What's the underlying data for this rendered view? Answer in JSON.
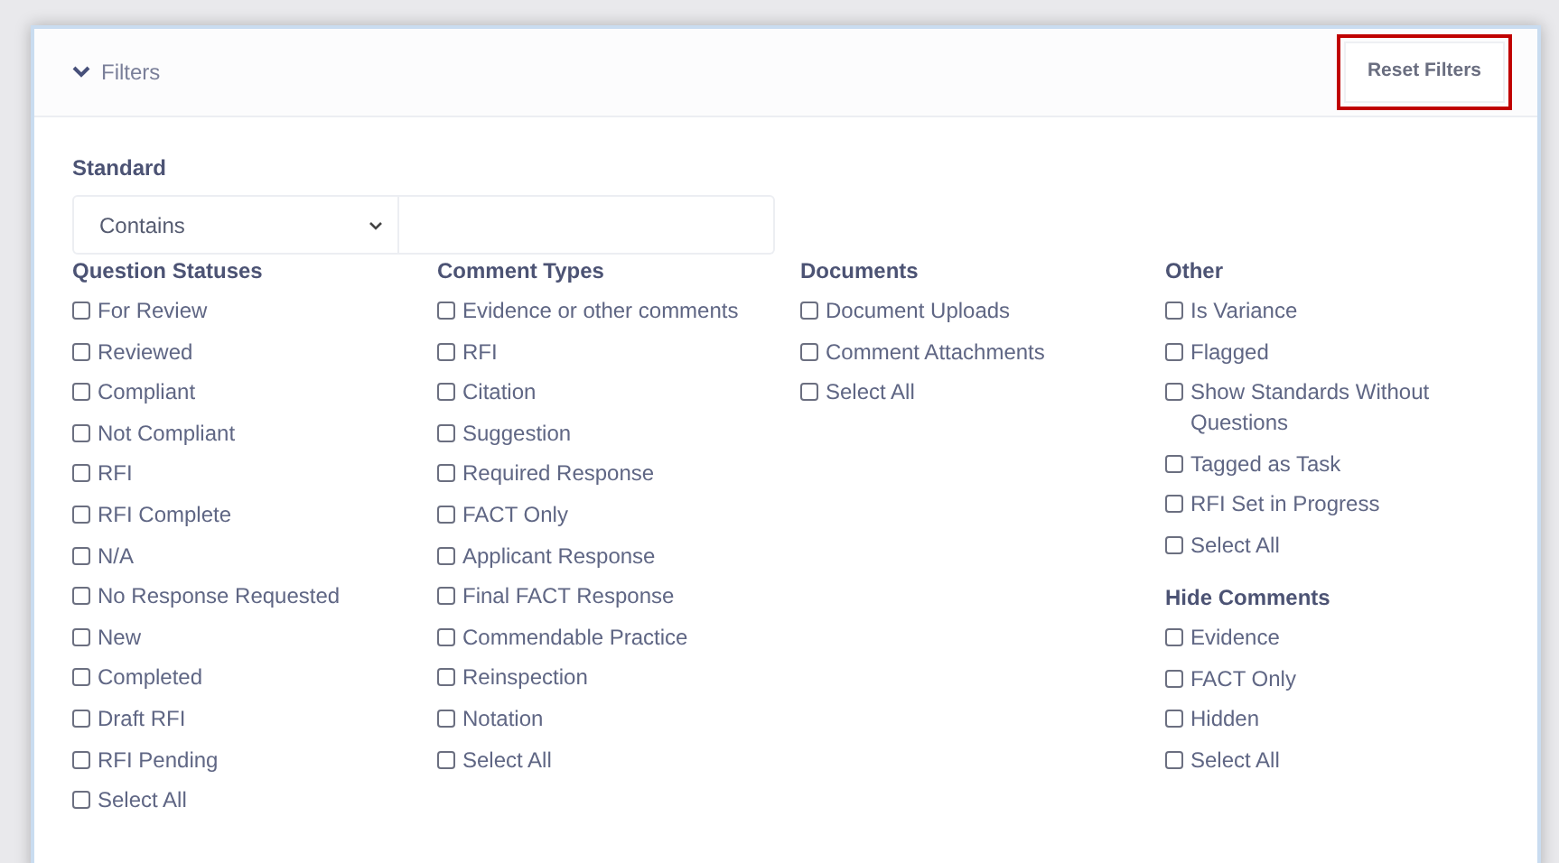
{
  "header": {
    "title": "Filters",
    "expanded": true,
    "reset_button": {
      "label": "Reset Filters",
      "highlighted": true
    }
  },
  "standard": {
    "label": "Standard",
    "operator": "Contains"
  },
  "columns": [
    {
      "groups": [
        {
          "title": "Question Statuses",
          "items": [
            {
              "label": "For Review",
              "checked": false
            },
            {
              "label": "Reviewed",
              "checked": false
            },
            {
              "label": "Compliant",
              "checked": false
            },
            {
              "label": "Not Compliant",
              "checked": false
            },
            {
              "label": "RFI",
              "checked": false
            },
            {
              "label": "RFI Complete",
              "checked": false
            },
            {
              "label": "N/A",
              "checked": false
            },
            {
              "label": "No Response Requested",
              "checked": false
            },
            {
              "label": "New",
              "checked": false
            },
            {
              "label": "Completed",
              "checked": false
            },
            {
              "label": "Draft RFI",
              "checked": false
            },
            {
              "label": "RFI Pending",
              "checked": false
            },
            {
              "label": "Select All",
              "checked": false
            }
          ]
        }
      ]
    },
    {
      "groups": [
        {
          "title": "Comment Types",
          "items": [
            {
              "label": "Evidence or other comments",
              "checked": false
            },
            {
              "label": "RFI",
              "checked": false
            },
            {
              "label": "Citation",
              "checked": false
            },
            {
              "label": "Suggestion",
              "checked": false
            },
            {
              "label": "Required Response",
              "checked": false
            },
            {
              "label": "FACT Only",
              "checked": false
            },
            {
              "label": "Applicant Response",
              "checked": false
            },
            {
              "label": "Final FACT Response",
              "checked": false
            },
            {
              "label": "Commendable Practice",
              "checked": false
            },
            {
              "label": "Reinspection",
              "checked": false
            },
            {
              "label": "Notation",
              "checked": false
            },
            {
              "label": "Select All",
              "checked": false
            }
          ]
        }
      ]
    },
    {
      "groups": [
        {
          "title": "Documents",
          "items": [
            {
              "label": "Document Uploads",
              "checked": false
            },
            {
              "label": "Comment Attachments",
              "checked": false
            },
            {
              "label": "Select All",
              "checked": false
            }
          ]
        }
      ]
    },
    {
      "groups": [
        {
          "title": "Other",
          "items": [
            {
              "label": "Is Variance",
              "checked": false
            },
            {
              "label": "Flagged",
              "checked": false
            },
            {
              "label": "Show Standards Without Questions",
              "checked": false
            },
            {
              "label": "Tagged as Task",
              "checked": false
            },
            {
              "label": "RFI Set in Progress",
              "checked": false
            },
            {
              "label": "Select All",
              "checked": false
            }
          ]
        },
        {
          "title": "Hide Comments",
          "items": [
            {
              "label": "Evidence",
              "checked": false
            },
            {
              "label": "FACT Only",
              "checked": false
            },
            {
              "label": "Hidden",
              "checked": false
            },
            {
              "label": "Select All",
              "checked": false
            }
          ]
        }
      ]
    }
  ]
}
